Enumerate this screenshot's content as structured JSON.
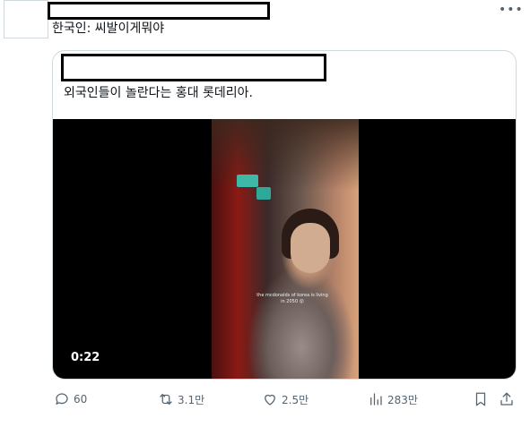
{
  "tweet": {
    "text": "한국인: 씨발이게뭐야",
    "more_icon": "more-icon"
  },
  "quote": {
    "text": "외국인들이 놀란다는 홍대 롯데리아.",
    "video": {
      "duration": "0:22",
      "caption": "the mcdonalds of korea is living in 2050 😮"
    }
  },
  "actions": {
    "reply": {
      "icon": "reply-icon",
      "count": "60"
    },
    "retweet": {
      "icon": "retweet-icon",
      "count": "3.1만"
    },
    "like": {
      "icon": "heart-icon",
      "count": "2.5만"
    },
    "views": {
      "icon": "analytics-icon",
      "count": "283만"
    },
    "bookmark": {
      "icon": "bookmark-icon"
    },
    "share": {
      "icon": "share-icon"
    }
  },
  "colors": {
    "text": "#0f1419",
    "muted": "#536471",
    "border": "#cfd9de",
    "video_bg": "#000000"
  }
}
